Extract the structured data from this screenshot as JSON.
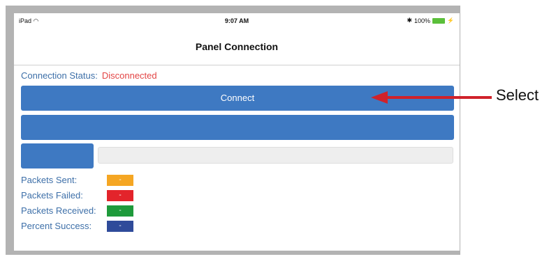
{
  "status_bar": {
    "device": "iPad",
    "wifi_icon": "wifi-icon",
    "time": "9:07 AM",
    "battery": "100%",
    "battery_level": 1.0
  },
  "nav": {
    "title": "Panel Connection"
  },
  "connection": {
    "label": "Connection Status:",
    "value": "Disconnected",
    "value_color": "#e34545"
  },
  "buttons": {
    "connect": "Connect",
    "second": "",
    "small": ""
  },
  "text_field": {
    "value": ""
  },
  "stats": [
    {
      "label": "Packets Sent:",
      "value": "-",
      "color": "#f5a623"
    },
    {
      "label": "Packets Failed:",
      "value": "-",
      "color": "#e3242b"
    },
    {
      "label": "Packets Received:",
      "value": "-",
      "color": "#1e9a3b"
    },
    {
      "label": "Percent Success:",
      "value": "-",
      "color": "#2f4b9a"
    }
  ],
  "annotation": {
    "label": "Select",
    "color": "#d0222a"
  },
  "colors": {
    "accent": "#3e79c2",
    "label_text": "#3d6fa8"
  }
}
